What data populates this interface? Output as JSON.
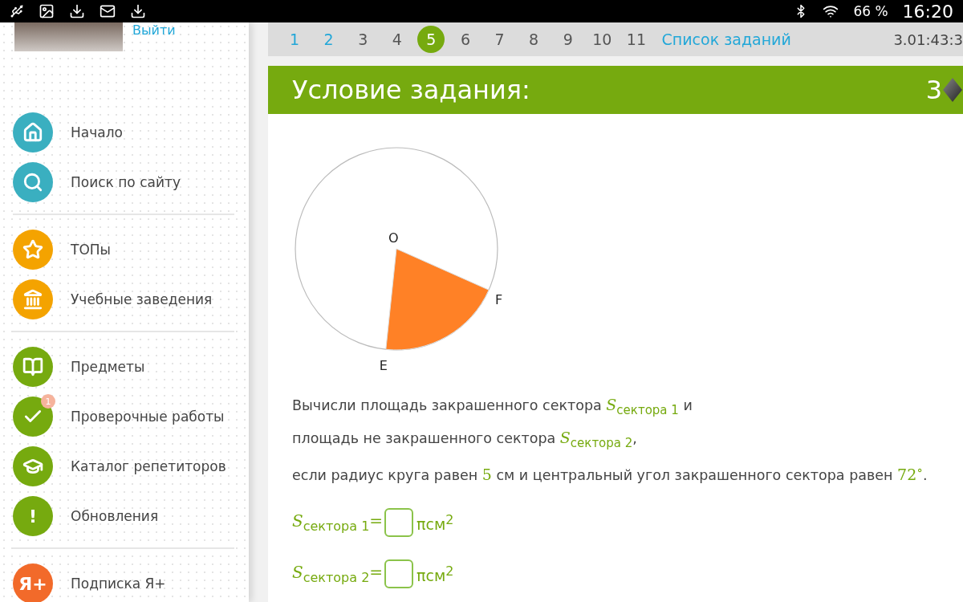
{
  "status_bar": {
    "battery": "66 %",
    "time": "16:20"
  },
  "user": {
    "logout": "Выйти"
  },
  "sidebar": {
    "groups": [
      [
        {
          "label": "Начало",
          "color": "#3aafc0"
        },
        {
          "label": "Поиск по сайту",
          "color": "#3aafc0"
        }
      ],
      [
        {
          "label": "ТОПы",
          "color": "#f4a300"
        },
        {
          "label": "Учебные заведения",
          "color": "#f4a300"
        }
      ],
      [
        {
          "label": "Предметы",
          "color": "#76aa0f"
        },
        {
          "label": "Проверочные работы",
          "color": "#76aa0f",
          "badge": "1"
        },
        {
          "label": "Каталог репетиторов",
          "color": "#76aa0f"
        },
        {
          "label": "Обновления",
          "glyph": "!",
          "color": "#76aa0f"
        }
      ],
      [
        {
          "label": "Подписка Я+",
          "glyph": "Я+",
          "color": "#f26a2a"
        }
      ]
    ]
  },
  "task_nav": {
    "items": [
      {
        "label": "1",
        "visited": true,
        "selected": false
      },
      {
        "label": "2",
        "visited": true,
        "selected": false
      },
      {
        "label": "3",
        "visited": false,
        "selected": false
      },
      {
        "label": "4",
        "visited": false,
        "selected": false
      },
      {
        "label": "5",
        "visited": false,
        "selected": true
      },
      {
        "label": "6",
        "visited": false,
        "selected": false
      },
      {
        "label": "7",
        "visited": false,
        "selected": false
      },
      {
        "label": "8",
        "visited": false,
        "selected": false
      },
      {
        "label": "9",
        "visited": false,
        "selected": false
      },
      {
        "label": "10",
        "visited": false,
        "selected": false
      },
      {
        "label": "11",
        "visited": false,
        "selected": false
      }
    ],
    "list_link": "Список заданий",
    "timer": "3.01:43:3"
  },
  "task": {
    "title": "Условие задания:",
    "points": "3",
    "figure": {
      "labels": [
        "O",
        "F",
        "E"
      ]
    },
    "lines": [
      [
        {
          "kind": "text",
          "text": "Вычисли площадь закрашенного сектора "
        },
        {
          "kind": "math",
          "text": "*S*$_{сектора 1}$"
        },
        {
          "kind": "text",
          "text": " и"
        }
      ],
      [
        {
          "kind": "text",
          "text": "площадь не закрашенного сектора "
        },
        {
          "kind": "math",
          "text": "*S*$_{сектора 2}$"
        },
        {
          "kind": "text",
          "text": ","
        }
      ],
      [
        {
          "kind": "text",
          "text": "если радиус круга равен "
        },
        {
          "kind": "math",
          "text": "5"
        },
        {
          "kind": "text",
          "text": " см и центральный угол закрашенного сектора равен "
        },
        {
          "kind": "math",
          "text": "72$^{∘}$"
        },
        {
          "kind": "text",
          "text": "."
        }
      ]
    ],
    "answers": [
      {
        "label": "*S*$_{сектора 1}$=",
        "unit": "πсм$^{2}$"
      },
      {
        "label": "*S*$_{сектора 2}$=",
        "unit": "πсм$^{2}$"
      }
    ]
  }
}
